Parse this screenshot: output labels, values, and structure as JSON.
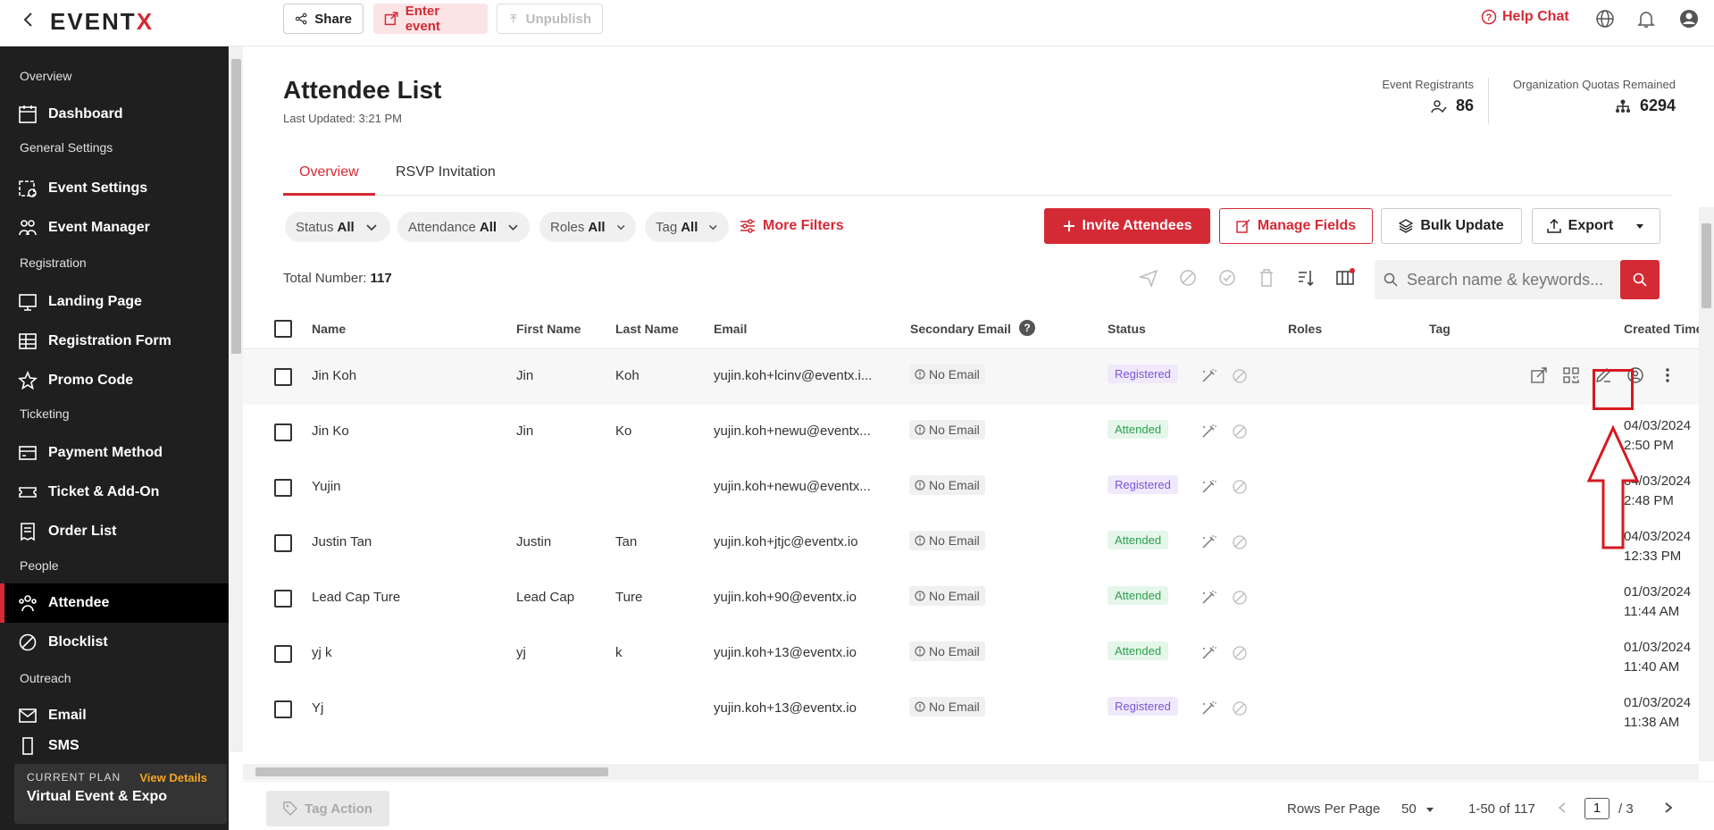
{
  "topbar": {
    "logo_prefix": "EVENT",
    "logo_x": "X",
    "share_label": "Share",
    "enter_label": "Enter event",
    "unpublish_label": "Unpublish",
    "help_label": "Help Chat"
  },
  "sidebar": {
    "sections": {
      "overview": "Overview",
      "general": "General Settings",
      "registration": "Registration",
      "ticketing": "Ticketing",
      "people": "People",
      "outreach": "Outreach"
    },
    "items": {
      "dashboard": "Dashboard",
      "event_settings": "Event Settings",
      "event_manager": "Event Manager",
      "landing_page": "Landing Page",
      "registration_form": "Registration Form",
      "promo_code": "Promo Code",
      "payment_method": "Payment Method",
      "ticket_addon": "Ticket & Add-On",
      "order_list": "Order List",
      "attendee": "Attendee",
      "blocklist": "Blocklist",
      "email": "Email",
      "sms": "SMS"
    },
    "plan": {
      "label": "CURRENT PLAN",
      "link": "View Details",
      "name": "Virtual Event & Expo"
    }
  },
  "page": {
    "title": "Attendee List",
    "updated": "Last Updated: 3:21 PM",
    "registrants_label": "Event Registrants",
    "registrants_value": "86",
    "quota_label": "Organization Quotas Remained",
    "quota_value": "6294",
    "tabs": [
      "Overview",
      "RSVP Invitation"
    ]
  },
  "filters": {
    "status": {
      "label": "Status",
      "value": "All"
    },
    "attendance": {
      "label": "Attendance",
      "value": "All"
    },
    "roles": {
      "label": "Roles",
      "value": "All"
    },
    "tag": {
      "label": "Tag",
      "value": "All"
    },
    "more": "More Filters"
  },
  "actions": {
    "invite": "Invite Attendees",
    "manage": "Manage Fields",
    "bulk": "Bulk Update",
    "export": "Export"
  },
  "total": {
    "label": "Total Number:",
    "value": "117"
  },
  "search": {
    "placeholder": "Search name & keywords..."
  },
  "table": {
    "headers": {
      "name": "Name",
      "first": "First Name",
      "last": "Last Name",
      "email": "Email",
      "secondary": "Secondary Email",
      "status": "Status",
      "roles": "Roles",
      "tag": "Tag",
      "created": "Created Time"
    },
    "no_email": "No Email",
    "rows": [
      {
        "name": "Jin Koh",
        "first": "Jin",
        "last": "Koh",
        "email": "yujin.koh+lcinv@eventx.i...",
        "status": "Registered",
        "created_date": "",
        "created_time": ""
      },
      {
        "name": "Jin Ko",
        "first": "Jin",
        "last": "Ko",
        "email": "yujin.koh+newu@eventx...",
        "status": "Attended",
        "created_date": "04/03/2024",
        "created_time": "2:50 PM"
      },
      {
        "name": "Yujin",
        "first": "",
        "last": "",
        "email": "yujin.koh+newu@eventx...",
        "status": "Registered",
        "created_date": "04/03/2024",
        "created_time": "2:48 PM"
      },
      {
        "name": "Justin Tan",
        "first": "Justin",
        "last": "Tan",
        "email": "yujin.koh+jtjc@eventx.io",
        "status": "Attended",
        "created_date": "04/03/2024",
        "created_time": "12:33 PM"
      },
      {
        "name": "Lead Cap Ture",
        "first": "Lead Cap",
        "last": "Ture",
        "email": "yujin.koh+90@eventx.io",
        "status": "Attended",
        "created_date": "01/03/2024",
        "created_time": "11:44 AM"
      },
      {
        "name": "yj k",
        "first": "yj",
        "last": "k",
        "email": "yujin.koh+13@eventx.io",
        "status": "Attended",
        "created_date": "01/03/2024",
        "created_time": "11:40 AM"
      },
      {
        "name": "Yj",
        "first": "",
        "last": "",
        "email": "yujin.koh+13@eventx.io",
        "status": "Registered",
        "created_date": "01/03/2024",
        "created_time": "11:38 AM"
      }
    ]
  },
  "footer": {
    "tag_action": "Tag Action",
    "rows_per_page_label": "Rows Per Page",
    "rows_per_page": "50",
    "range": "1-50 of 117",
    "page": "1",
    "total_pages": "/ 3"
  },
  "colors": {
    "accent": "#d42a35",
    "registered": "#7a55d6",
    "attended": "#2ea04f"
  }
}
